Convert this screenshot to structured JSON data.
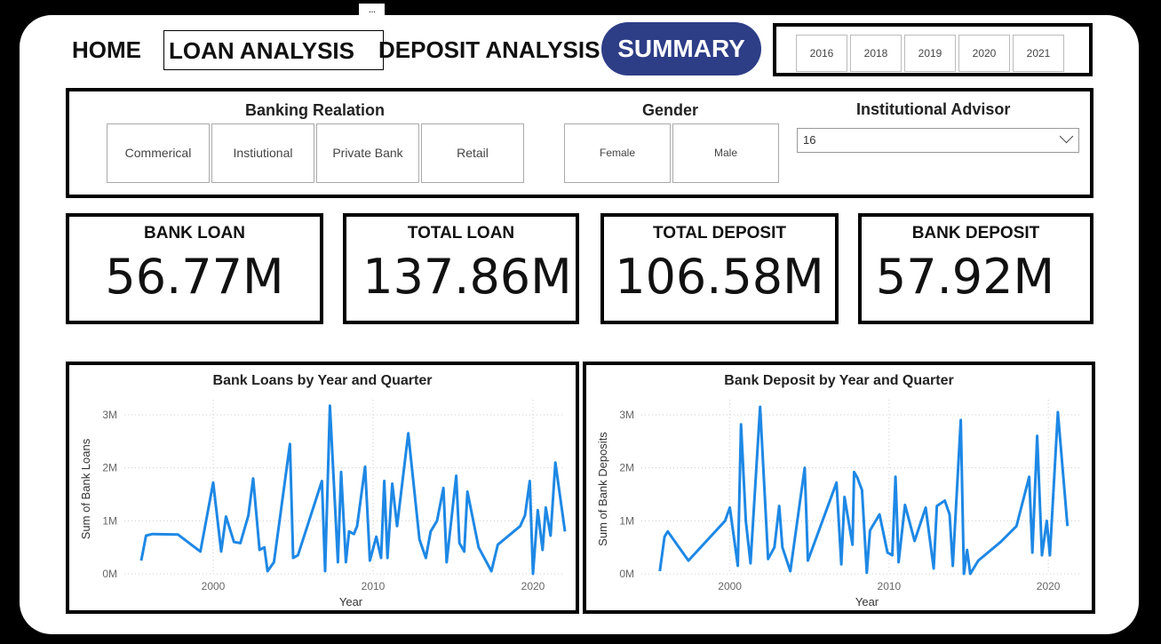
{
  "nav": {
    "home": "HOME",
    "loan_analysis": "LOAN ANALYSIS",
    "deposit_analysis": "DEPOSIT ANALYSIS",
    "summary": "SUMMARY",
    "more": "..."
  },
  "years": [
    "2016",
    "2018",
    "2019",
    "2020",
    "2021"
  ],
  "filters": {
    "banking_relation": {
      "title": "Banking Realation",
      "options": [
        "Commerical",
        "Instiutional",
        "Private Bank",
        "Retail"
      ]
    },
    "gender": {
      "title": "Gender",
      "options": [
        "Female",
        "Male"
      ]
    },
    "advisor": {
      "title": "Institutional Advisor",
      "selected": "16"
    }
  },
  "cards": [
    {
      "label": "BANK LOAN",
      "value": "56.77M"
    },
    {
      "label": "TOTAL LOAN",
      "value": "137.86M"
    },
    {
      "label": "TOTAL DEPOSIT",
      "value": "106.58M"
    },
    {
      "label": "BANK DEPOSIT",
      "value": "57.92M"
    }
  ],
  "colors": {
    "accent": "#2d3e87",
    "line": "#1e88e5"
  },
  "chart_data": [
    {
      "type": "line",
      "title": "Bank Loans by Year and Quarter",
      "xlabel": "Year",
      "ylabel": "Sum of Bank Loans",
      "xlim": [
        1995,
        2022
      ],
      "ylim": [
        0,
        3.2
      ],
      "y_ticks": [
        "0M",
        "1M",
        "2M",
        "3M"
      ],
      "x_ticks": [
        "2000",
        "2010",
        "2020"
      ],
      "grid": true,
      "series": [
        {
          "points": [
            [
              1995.5,
              0.25
            ],
            [
              1995.8,
              0.72
            ],
            [
              1996.2,
              0.75
            ],
            [
              1997.8,
              0.74
            ],
            [
              1999.2,
              0.42
            ],
            [
              2000.0,
              1.72
            ],
            [
              2000.5,
              0.42
            ],
            [
              2000.8,
              1.08
            ],
            [
              2001.3,
              0.6
            ],
            [
              2001.7,
              0.58
            ],
            [
              2002.2,
              1.1
            ],
            [
              2002.5,
              1.8
            ],
            [
              2002.9,
              0.45
            ],
            [
              2003.2,
              0.5
            ],
            [
              2003.4,
              0.05
            ],
            [
              2003.8,
              0.22
            ],
            [
              2004.8,
              2.45
            ],
            [
              2005.0,
              0.3
            ],
            [
              2005.3,
              0.35
            ],
            [
              2006.8,
              1.75
            ],
            [
              2007.0,
              0.05
            ],
            [
              2007.3,
              3.17
            ],
            [
              2007.8,
              0.22
            ],
            [
              2008.0,
              1.92
            ],
            [
              2008.3,
              0.22
            ],
            [
              2008.5,
              0.8
            ],
            [
              2008.8,
              0.75
            ],
            [
              2009.0,
              0.9
            ],
            [
              2009.5,
              2.02
            ],
            [
              2009.8,
              0.25
            ],
            [
              2010.2,
              0.7
            ],
            [
              2010.5,
              0.3
            ],
            [
              2010.7,
              1.75
            ],
            [
              2010.9,
              0.3
            ],
            [
              2011.2,
              1.7
            ],
            [
              2011.5,
              0.9
            ],
            [
              2012.2,
              2.65
            ],
            [
              2012.9,
              0.65
            ],
            [
              2013.3,
              0.3
            ],
            [
              2013.6,
              0.8
            ],
            [
              2014.0,
              1.0
            ],
            [
              2014.4,
              1.62
            ],
            [
              2014.6,
              0.22
            ],
            [
              2015.2,
              1.85
            ],
            [
              2015.4,
              0.58
            ],
            [
              2015.7,
              0.42
            ],
            [
              2015.9,
              1.55
            ],
            [
              2016.6,
              0.5
            ],
            [
              2017.4,
              0.05
            ],
            [
              2017.8,
              0.55
            ],
            [
              2019.2,
              0.9
            ],
            [
              2019.5,
              1.1
            ],
            [
              2019.8,
              1.75
            ],
            [
              2020.0,
              0.0
            ],
            [
              2020.3,
              1.2
            ],
            [
              2020.6,
              0.45
            ],
            [
              2020.8,
              1.25
            ],
            [
              2021.1,
              0.72
            ],
            [
              2021.4,
              2.1
            ],
            [
              2022.0,
              0.8
            ]
          ]
        }
      ]
    },
    {
      "type": "line",
      "title": "Bank Deposit by Year and Quarter",
      "xlabel": "Year",
      "ylabel": "Sum of Bank Deposits",
      "xlim": [
        1995,
        2022
      ],
      "ylim": [
        0,
        3.2
      ],
      "y_ticks": [
        "0M",
        "1M",
        "2M",
        "3M"
      ],
      "x_ticks": [
        "2000",
        "2010",
        "2020"
      ],
      "grid": true,
      "series": [
        {
          "points": [
            [
              1995.6,
              0.05
            ],
            [
              1995.9,
              0.7
            ],
            [
              1996.1,
              0.8
            ],
            [
              1997.4,
              0.25
            ],
            [
              1999.7,
              1.0
            ],
            [
              2000.0,
              1.25
            ],
            [
              2000.5,
              0.15
            ],
            [
              2000.7,
              2.82
            ],
            [
              2001.0,
              1.0
            ],
            [
              2001.3,
              0.2
            ],
            [
              2001.9,
              3.15
            ],
            [
              2002.4,
              0.28
            ],
            [
              2002.8,
              0.5
            ],
            [
              2003.1,
              1.28
            ],
            [
              2003.3,
              0.5
            ],
            [
              2003.8,
              0.05
            ],
            [
              2004.7,
              2.0
            ],
            [
              2004.9,
              0.25
            ],
            [
              2006.7,
              1.72
            ],
            [
              2007.0,
              0.18
            ],
            [
              2007.2,
              1.45
            ],
            [
              2007.7,
              0.55
            ],
            [
              2007.8,
              1.92
            ],
            [
              2008.0,
              1.82
            ],
            [
              2008.3,
              1.58
            ],
            [
              2008.6,
              0.02
            ],
            [
              2008.8,
              0.82
            ],
            [
              2009.4,
              1.12
            ],
            [
              2009.9,
              0.4
            ],
            [
              2010.2,
              0.35
            ],
            [
              2010.4,
              1.83
            ],
            [
              2010.6,
              0.22
            ],
            [
              2011.0,
              1.3
            ],
            [
              2011.6,
              0.62
            ],
            [
              2012.3,
              1.25
            ],
            [
              2012.8,
              0.1
            ],
            [
              2013.0,
              1.28
            ],
            [
              2013.5,
              1.38
            ],
            [
              2013.8,
              1.12
            ],
            [
              2014.0,
              0.15
            ],
            [
              2014.5,
              2.9
            ],
            [
              2014.7,
              0.0
            ],
            [
              2014.9,
              0.45
            ],
            [
              2015.1,
              0.0
            ],
            [
              2015.6,
              0.25
            ],
            [
              2016.6,
              0.5
            ],
            [
              2017.0,
              0.6
            ],
            [
              2018.0,
              0.9
            ],
            [
              2018.8,
              1.83
            ],
            [
              2019.0,
              0.4
            ],
            [
              2019.3,
              2.6
            ],
            [
              2019.6,
              0.35
            ],
            [
              2019.9,
              1.0
            ],
            [
              2020.1,
              0.35
            ],
            [
              2020.6,
              3.05
            ],
            [
              2021.2,
              0.9
            ]
          ]
        }
      ]
    }
  ]
}
